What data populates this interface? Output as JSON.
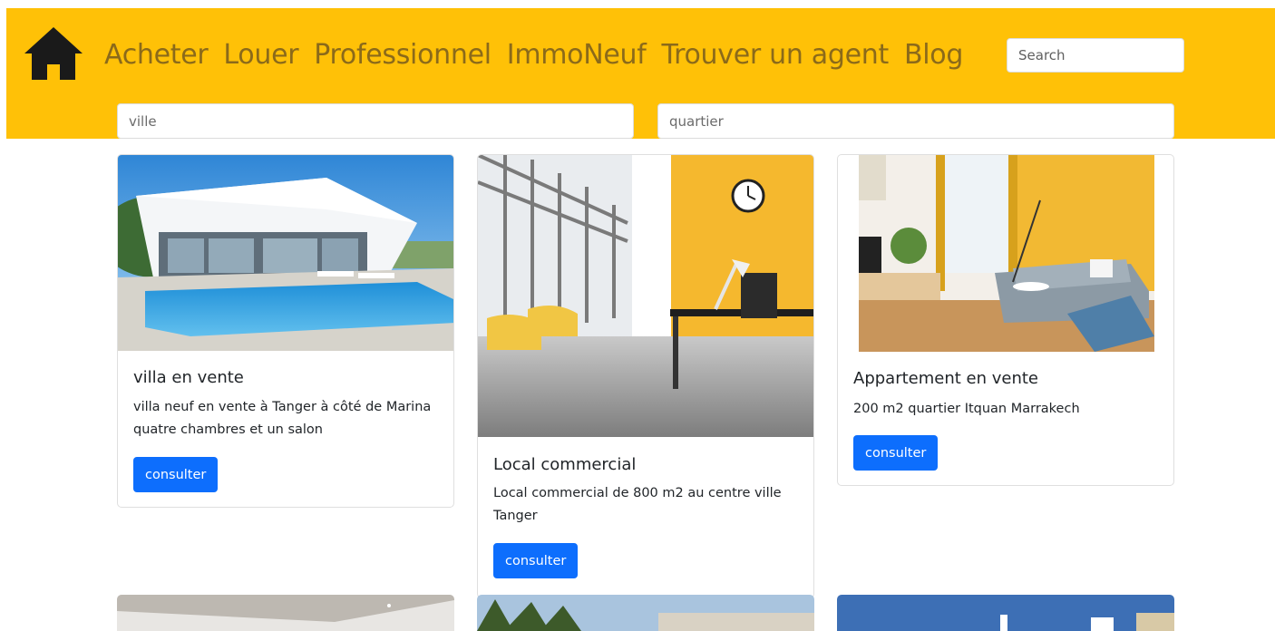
{
  "nav": {
    "items": [
      "Acheter",
      "Louer",
      "Professionnel",
      "ImmoNeuf",
      "Trouver un agent",
      "Blog"
    ],
    "search_placeholder": "Search"
  },
  "filters": {
    "ville_placeholder": "ville",
    "quartier_placeholder": "quartier"
  },
  "listings": [
    {
      "title": "villa en vente",
      "description_lines": [
        "villa neuf en vente à Tanger à côté de Marina",
        "quatre chambres et un salon"
      ],
      "button": "consulter"
    },
    {
      "title": "Local commercial",
      "description_lines": [
        "Local commercial de 800 m2 au centre ville",
        "Tanger"
      ],
      "button": "consulter"
    },
    {
      "title": "Appartement en vente",
      "description_lines": [
        "200 m2 quartier Itquan Marrakech"
      ],
      "button": "consulter"
    }
  ],
  "colors": {
    "header_bg": "#ffc107",
    "nav_text": "#8b6a1a",
    "button_bg": "#0d6efd"
  },
  "icons": {
    "home": "home-icon"
  }
}
